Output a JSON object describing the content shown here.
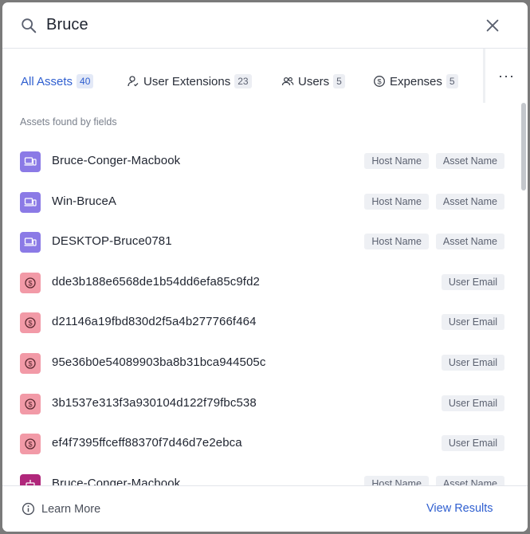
{
  "search": {
    "query": "Bruce"
  },
  "tabs": [
    {
      "label": "All Assets",
      "count": "40",
      "icon": "box-icon"
    },
    {
      "label": "User Extensions",
      "count": "23",
      "icon": "user-extension-icon"
    },
    {
      "label": "Users",
      "count": "5",
      "icon": "users-icon"
    },
    {
      "label": "Expenses",
      "count": "5",
      "icon": "dollar-icon"
    }
  ],
  "more_label": "···",
  "section_title": "Assets found by fields",
  "results": [
    {
      "name": "Bruce-Conger-Macbook",
      "type": "device",
      "tags": [
        "Host Name",
        "Asset Name"
      ]
    },
    {
      "name": "Win-BruceA",
      "type": "device",
      "tags": [
        "Host Name",
        "Asset Name"
      ]
    },
    {
      "name": "DESKTOP-Bruce0781",
      "type": "device",
      "tags": [
        "Host Name",
        "Asset Name"
      ]
    },
    {
      "name": "dde3b188e6568de1b54dd6efa85c9fd2",
      "type": "expense",
      "tags": [
        "User Email"
      ]
    },
    {
      "name": "d21146a19fbd830d2f5a4b277766f464",
      "type": "expense",
      "tags": [
        "User Email"
      ]
    },
    {
      "name": "95e36b0e54089903ba8b31bca944505c",
      "type": "expense",
      "tags": [
        "User Email"
      ]
    },
    {
      "name": "3b1537e313f3a930104d122f79fbc538",
      "type": "expense",
      "tags": [
        "User Email"
      ]
    },
    {
      "name": "ef4f7395ffceff88370f7d46d7e2ebca",
      "type": "expense",
      "tags": [
        "User Email"
      ]
    },
    {
      "name": "Bruce-Conger-Macbook",
      "type": "ext",
      "tags": [
        "Host Name",
        "Asset Name"
      ]
    }
  ],
  "footer": {
    "learn_more": "Learn More",
    "view_results": "View Results"
  },
  "colors": {
    "accent": "#2f5fd0",
    "device_icon": "#8b7ae6",
    "expense_icon": "#f29aa7",
    "extension_icon": "#b0277b"
  }
}
